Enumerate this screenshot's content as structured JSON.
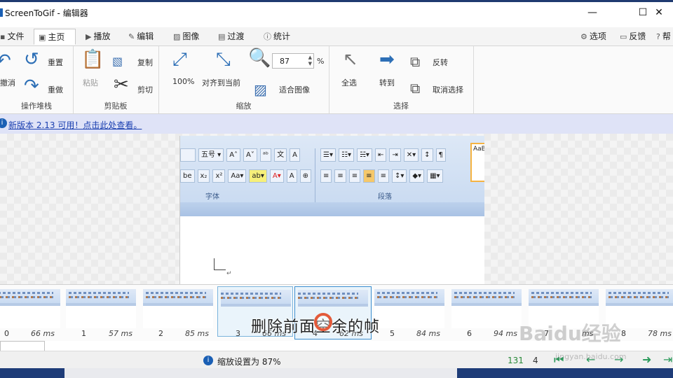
{
  "window": {
    "title": "ScreenToGif - 编辑器",
    "min": "—",
    "max": "☐",
    "close": "✕"
  },
  "tabs": [
    {
      "label": "文件",
      "icon": "save-icon"
    },
    {
      "label": "主页",
      "icon": "home-icon"
    },
    {
      "label": "播放",
      "icon": "play-icon"
    },
    {
      "label": "编辑",
      "icon": "pencil-icon"
    },
    {
      "label": "图像",
      "icon": "image-icon"
    },
    {
      "label": "过渡",
      "icon": "transition-icon"
    },
    {
      "label": "统计",
      "icon": "info-icon"
    }
  ],
  "right_menu": {
    "options": "选项",
    "feedback": "反馈",
    "help": "帮"
  },
  "ribbon": {
    "undo": "撤消",
    "redo": "重置",
    "redo2": "重做",
    "group_history": "操作堆栈",
    "paste": "粘贴",
    "copy": "复制",
    "cut": "剪切",
    "group_clipboard": "剪贴板",
    "zoom100": "100%",
    "fit_align": "对齐到当前",
    "zoom_value": "87",
    "zoom_unit": "%",
    "fit_image": "适合图像",
    "group_zoom": "缩放",
    "select_all": "全选",
    "go_to": "转到",
    "invert": "反转",
    "deselect": "取消选择",
    "group_select": "选择"
  },
  "notice": {
    "text": "新版本 2.13 可用！点击此处查看。",
    "icon": "info-icon"
  },
  "frame_preview": {
    "font_size": "五号",
    "group_font": "字体",
    "group_paragraph": "段落",
    "styles_label": "AaB",
    "para_mark": "↵"
  },
  "frames": [
    {
      "index": "0",
      "ms": "66 ms"
    },
    {
      "index": "1",
      "ms": "57 ms"
    },
    {
      "index": "2",
      "ms": "85 ms"
    },
    {
      "index": "3",
      "ms": "66 ms"
    },
    {
      "index": "4",
      "ms": "62 ms"
    },
    {
      "index": "5",
      "ms": "84 ms"
    },
    {
      "index": "6",
      "ms": "94 ms"
    },
    {
      "index": "7",
      "ms": "ms"
    },
    {
      "index": "8",
      "ms": "78 ms"
    }
  ],
  "subtitle": "删除前面空余的帧",
  "status": {
    "text": "缩放设置为 87%",
    "frame_count": "131",
    "current": "4"
  },
  "watermark": {
    "main": "Baidu经验",
    "sub": "jingyan.baidu.com"
  }
}
